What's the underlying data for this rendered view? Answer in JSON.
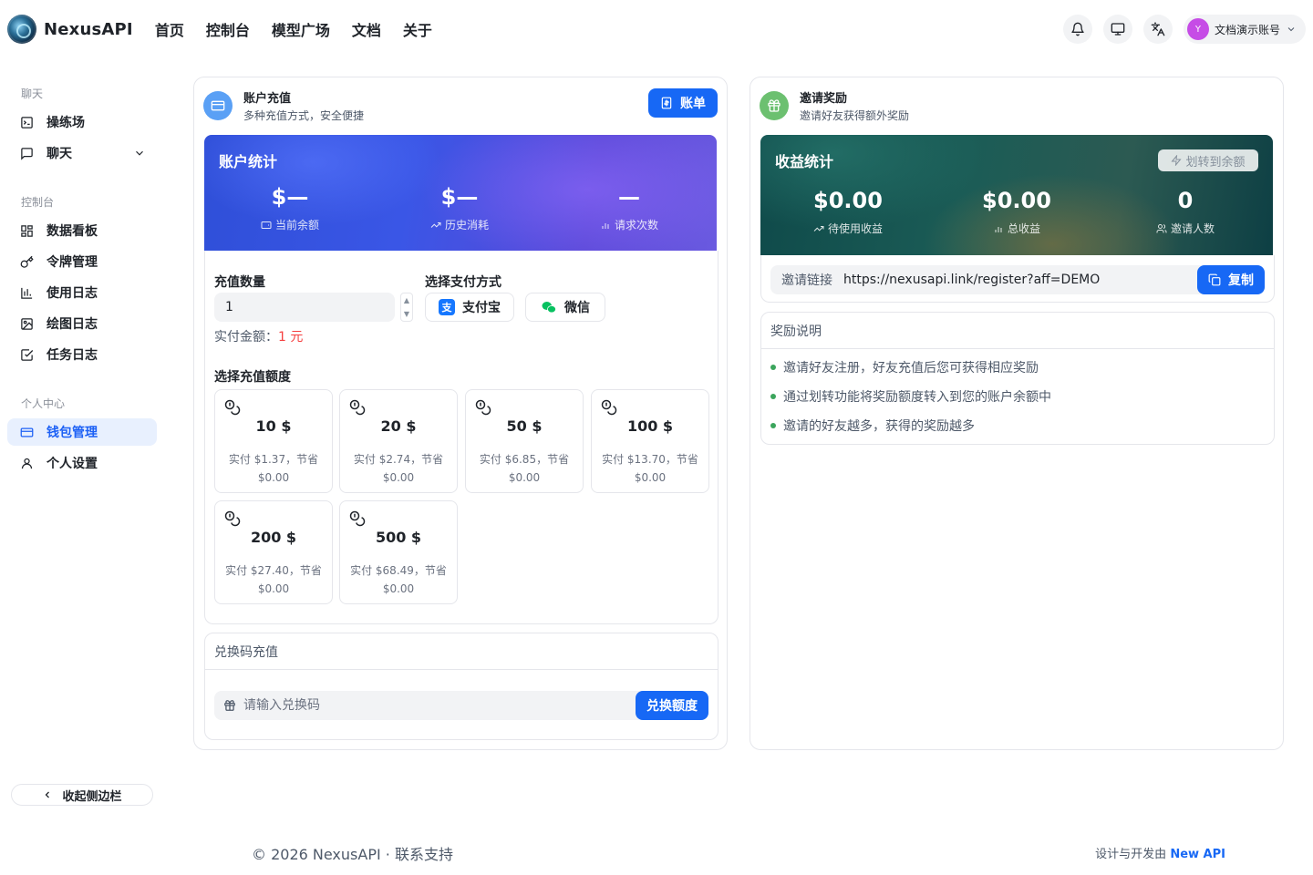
{
  "header": {
    "brand": "NexusAPI",
    "nav": [
      "首页",
      "控制台",
      "模型广场",
      "文档",
      "关于"
    ],
    "user": {
      "avatar_letter": "Y",
      "name": "文档演示账号",
      "avatar_color": "#c64ce6"
    },
    "icons": [
      "bell-icon",
      "monitor-icon",
      "translate-icon",
      "chevron-down-icon"
    ]
  },
  "sidebar": {
    "groups": [
      {
        "title": "聊天",
        "items": [
          {
            "label": "操练场",
            "icon": "terminal-icon"
          },
          {
            "label": "聊天",
            "icon": "chat-icon"
          }
        ]
      },
      {
        "title": "控制台",
        "items": [
          {
            "label": "数据看板",
            "icon": "dashboard-icon"
          },
          {
            "label": "令牌管理",
            "icon": "key-icon"
          },
          {
            "label": "使用日志",
            "icon": "bar-chart-icon"
          },
          {
            "label": "绘图日志",
            "icon": "image-icon"
          },
          {
            "label": "任务日志",
            "icon": "checkbox-icon"
          }
        ]
      },
      {
        "title": "个人中心",
        "items": [
          {
            "label": "钱包管理",
            "icon": "wallet-icon",
            "active": true
          },
          {
            "label": "个人设置",
            "icon": "user-icon"
          }
        ]
      }
    ],
    "collapse_label": "收起侧边栏"
  },
  "topup": {
    "title": "账户充值",
    "subtitle": "多种充值方式，安全便捷",
    "bill_button": "账单",
    "stats": {
      "title": "账户统计",
      "items": [
        {
          "value": "$—",
          "label": "当前余额"
        },
        {
          "value": "$—",
          "label": "历史消耗"
        },
        {
          "value": "—",
          "label": "请求次数"
        }
      ]
    },
    "quantity_label": "充值数量",
    "quantity_value": "1",
    "pay_label": "选择支付方式",
    "pay_methods": [
      "支付宝",
      "微信"
    ],
    "actual_label": "实付金额：",
    "actual_value": "1 元",
    "amount_label": "选择充值额度",
    "amounts": [
      {
        "amount": "10 $",
        "line1": "实付 $1.37，节省",
        "line2": "$0.00"
      },
      {
        "amount": "20 $",
        "line1": "实付 $2.74，节省",
        "line2": "$0.00"
      },
      {
        "amount": "50 $",
        "line1": "实付 $6.85，节省",
        "line2": "$0.00"
      },
      {
        "amount": "100 $",
        "line1": "实付 $13.70，节省",
        "line2": "$0.00"
      },
      {
        "amount": "200 $",
        "line1": "实付 $27.40，节省",
        "line2": "$0.00"
      },
      {
        "amount": "500 $",
        "line1": "实付 $68.49，节省",
        "line2": "$0.00"
      }
    ],
    "redeem": {
      "title": "兑换码充值",
      "placeholder": "请输入兑换码",
      "button": "兑换额度"
    }
  },
  "invite": {
    "title": "邀请奖励",
    "subtitle": "邀请好友获得额外奖励",
    "stats": {
      "title": "收益统计",
      "transfer_button": "划转到余额",
      "items": [
        {
          "value": "$0.00",
          "label": "待使用收益"
        },
        {
          "value": "$0.00",
          "label": "总收益"
        },
        {
          "value": "0",
          "label": "邀请人数"
        }
      ]
    },
    "link_label": "邀请链接",
    "link_value": "https://nexusapi.link/register?aff=DEMO",
    "copy_button": "复制",
    "rules_title": "奖励说明",
    "rules": [
      "邀请好友注册，好友充值后您可获得相应奖励",
      "通过划转功能将奖励额度转入到您的账户余额中",
      "邀请的好友越多，获得的奖励越多"
    ]
  },
  "footer": {
    "left": "© 2026 NexusAPI · 联系支持",
    "right_prefix": "设计与开发由",
    "right_link": "New API"
  },
  "colors": {
    "primary": "#1768f5",
    "active_bg": "#e8f0fe",
    "price_red": "#f53f3f",
    "bullet_green": "#3ba55c",
    "topup_icon_bg": "#5aa0f5",
    "invite_icon_bg": "#6cc070"
  }
}
